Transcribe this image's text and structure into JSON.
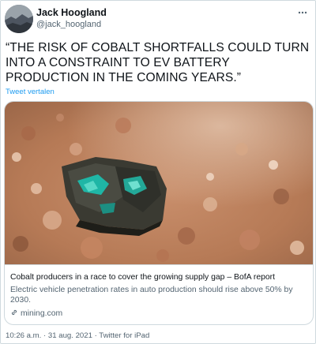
{
  "author": {
    "name": "Jack Hoogland",
    "handle": "@jack_hoogland"
  },
  "tweet": {
    "text": "“THE RISK OF COBALT SHORTFALLS COULD TURN INTO A CONSTRAINT TO EV BATTERY PRODUCTION IN THE COMING YEARS.”",
    "translate_label": "Tweet vertalen"
  },
  "card": {
    "title": "Cobalt producers in a race to cover the growing supply gap – BofA report",
    "description": "Electric vehicle penetration rates in auto production should rise above 50% by 2030.",
    "domain": "mining.com",
    "icons": {
      "domain": "link-icon"
    }
  },
  "meta": {
    "time": "10:26 a.m.",
    "separator": "·",
    "date": "31 aug. 2021",
    "client": "Twitter for iPad"
  },
  "icons": {
    "more": "more-options-icon"
  },
  "colors": {
    "link": "#1d9bf0",
    "secondary_text": "#536471",
    "border": "#cfd9de"
  }
}
